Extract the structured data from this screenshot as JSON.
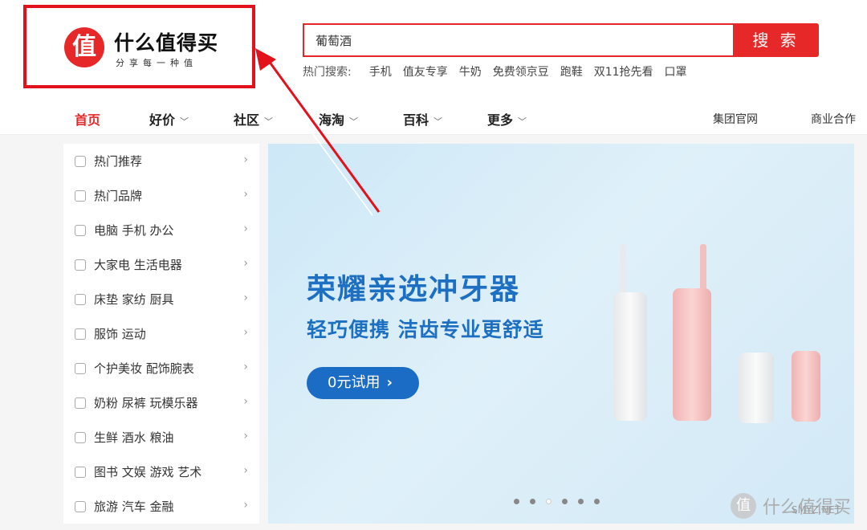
{
  "header": {
    "logo_glyph": "值",
    "logo_title": "什么值得买",
    "logo_subtitle": "分享每一种值"
  },
  "search": {
    "value": "葡萄酒",
    "button_label": "搜 索",
    "hot_label": "热门搜索:",
    "hot_items": [
      "手机",
      "值友专享",
      "牛奶",
      "免费领京豆",
      "跑鞋",
      "双11抢先看",
      "口罩"
    ]
  },
  "nav": {
    "items": [
      {
        "label": "首页",
        "active": true
      },
      {
        "label": "好价",
        "chevron": "﹀"
      },
      {
        "label": "社区",
        "chevron": "﹀"
      },
      {
        "label": "海淘",
        "chevron": "﹀"
      },
      {
        "label": "百科",
        "chevron": "﹀"
      },
      {
        "label": "更多",
        "chevron": "﹀"
      }
    ],
    "right_links": [
      "集团官网",
      "商业合作"
    ]
  },
  "sidebar": {
    "arrow": "›",
    "items": [
      {
        "label": "热门推荐",
        "icon": "document-icon"
      },
      {
        "label": "热门品牌",
        "icon": "tag-icon"
      },
      {
        "label": "电脑  手机  办公",
        "icon": "monitor-icon"
      },
      {
        "label": "大家电  生活电器",
        "icon": "washer-icon"
      },
      {
        "label": "床垫  家纺  厨具",
        "icon": "sofa-icon"
      },
      {
        "label": "服饰  运动",
        "icon": "shoe-icon"
      },
      {
        "label": "个护美妆  配饰腕表",
        "icon": "bottle-icon"
      },
      {
        "label": "奶粉  尿裤  玩模乐器",
        "icon": "baby-bottle-icon"
      },
      {
        "label": "生鲜  酒水  粮油",
        "icon": "fruit-icon"
      },
      {
        "label": "图书  文娱  游戏  艺术",
        "icon": "book-icon"
      },
      {
        "label": "旅游  汽车  金融",
        "icon": "car-icon"
      }
    ]
  },
  "banner": {
    "title": "荣耀亲选冲牙器",
    "subtitle": "轻巧便携 洁齿专业更舒适",
    "cta_label": "0元试用",
    "cta_arrow": "›",
    "slide_count": 6,
    "active_slide": 3
  },
  "watermark": {
    "glyph": "值",
    "text": "什么值得买",
    "url": "SMYZ.NET"
  },
  "colors": {
    "brand_red": "#e62828",
    "annotation_red": "#e3111b",
    "banner_blue": "#1d6fc1"
  }
}
